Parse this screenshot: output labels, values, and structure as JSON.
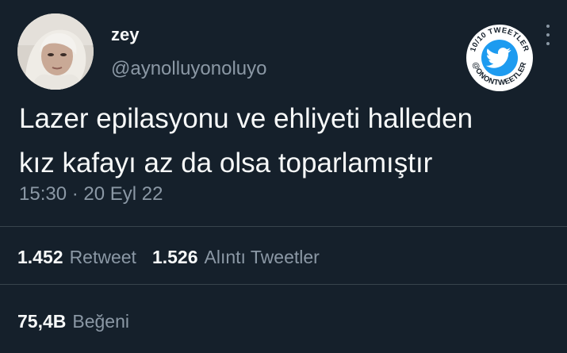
{
  "author": {
    "display_name": "zey",
    "handle": "@aynolluyonoluyo"
  },
  "badge": {
    "top_text": "10/10 TWEETLER",
    "bottom_text": "@ONONTWEETLER",
    "icon": "bird-icon",
    "accent_color": "#1d9bf0"
  },
  "tweet": {
    "lines": [
      "Lazer epilasyonu ve ehliyeti halleden",
      "kız kafayı az da olsa toparlamıştır"
    ],
    "timestamp": "15:30 · 20 Eyl 22"
  },
  "stats": {
    "retweets": {
      "count": "1.452",
      "label": "Retweet"
    },
    "quotes": {
      "count": "1.526",
      "label": "Alıntı Tweetler"
    },
    "likes": {
      "count": "75,4B",
      "label": "Beğeni"
    }
  },
  "colors": {
    "background": "#15202b",
    "primary_text": "#f7f9f9",
    "secondary_text": "#8b98a5",
    "divider": "#38444d"
  }
}
